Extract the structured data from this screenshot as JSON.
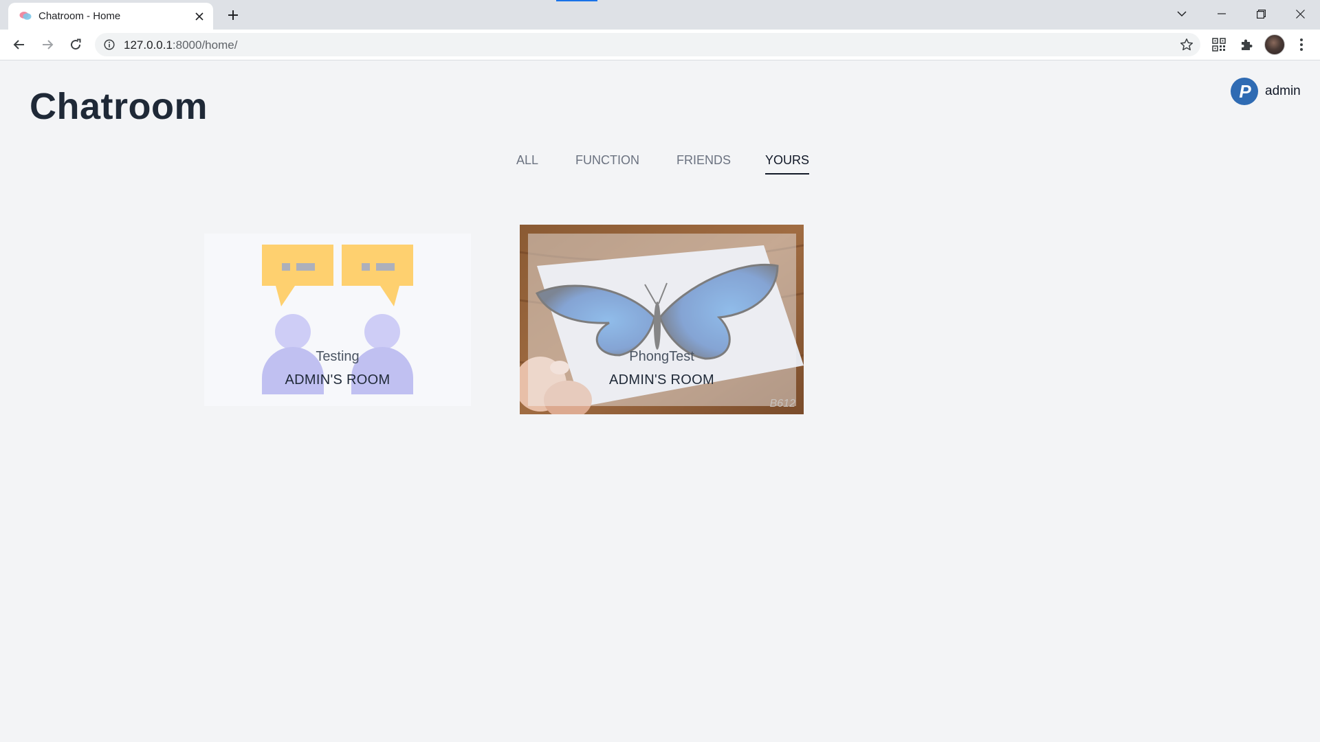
{
  "browser": {
    "tab_title": "Chatroom - Home",
    "url_host": "127.0.0.1",
    "url_path": ":8000/home/"
  },
  "page": {
    "title": "Chatroom",
    "user": {
      "name": "admin",
      "avatar_letter": "P"
    },
    "tabs": [
      {
        "label": "ALL",
        "active": false
      },
      {
        "label": "FUNCTION",
        "active": false
      },
      {
        "label": "FRIENDS",
        "active": false
      },
      {
        "label": "YOURS",
        "active": true
      }
    ],
    "rooms": [
      {
        "name": "Testing",
        "owner": "ADMIN'S ROOM",
        "image": "chat-users-illustration"
      },
      {
        "name": "PhongTest",
        "owner": "ADMIN'S ROOM",
        "image": "blue-butterfly-photo",
        "watermark": "B612"
      }
    ]
  },
  "colors": {
    "accent": "#1a73e8",
    "title": "#1f2937",
    "avatar": "#2f6bb3",
    "bubble": "#ffcb5c",
    "person": "#b9b9f0"
  }
}
